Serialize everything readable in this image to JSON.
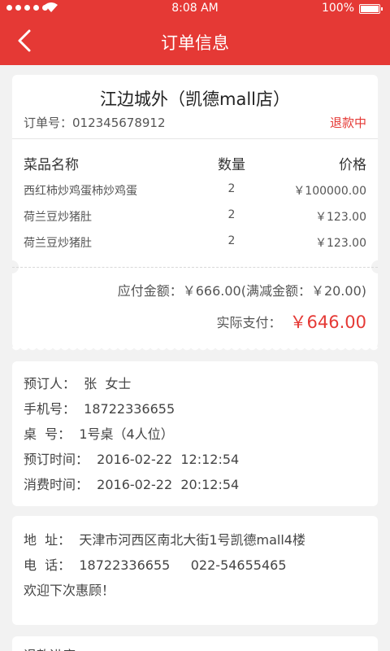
{
  "status_bar": {
    "time": "8:08 AM",
    "battery": "100%"
  },
  "nav": {
    "title": "订单信息"
  },
  "order": {
    "shop_name": "江边城外（凯德mall店）",
    "order_no": "订单号：012345678912",
    "status": "退款中",
    "columns": {
      "name": "菜品名称",
      "qty": "数量",
      "price": "价格"
    },
    "items": [
      {
        "name": "西红柿炒鸡蛋柿炒鸡蛋",
        "qty": "2",
        "price": "￥100000.00"
      },
      {
        "name": "荷兰豆炒猪肚",
        "qty": "2",
        "price": "￥123.00"
      },
      {
        "name": "荷兰豆炒猪肚",
        "qty": "2",
        "price": "￥123.00"
      }
    ],
    "payable": "应付金额：￥666.00(满减金额：￥20.00)",
    "actual_label": "实际支付：",
    "actual_amount": "￥646.00"
  },
  "booking": {
    "booker": "预订人：  张  女士",
    "phone": "手机号：  18722336655",
    "table": "桌  号：  1号桌（4人位）",
    "book_time": "预订时间：  2016-02-22  12:12:54",
    "consume_time": "消费时间：  2016-02-22  20:12:54"
  },
  "shop_info": {
    "address": "地  址：  天津市河西区南北大街1号凯德mall4楼",
    "tel": "电  话：  18722336655     022-54655465",
    "welcome": "欢迎下次惠顾！"
  },
  "refund": {
    "label": "退款进度："
  },
  "colors": {
    "accent": "#e53935",
    "background": "#f2f2f2"
  }
}
